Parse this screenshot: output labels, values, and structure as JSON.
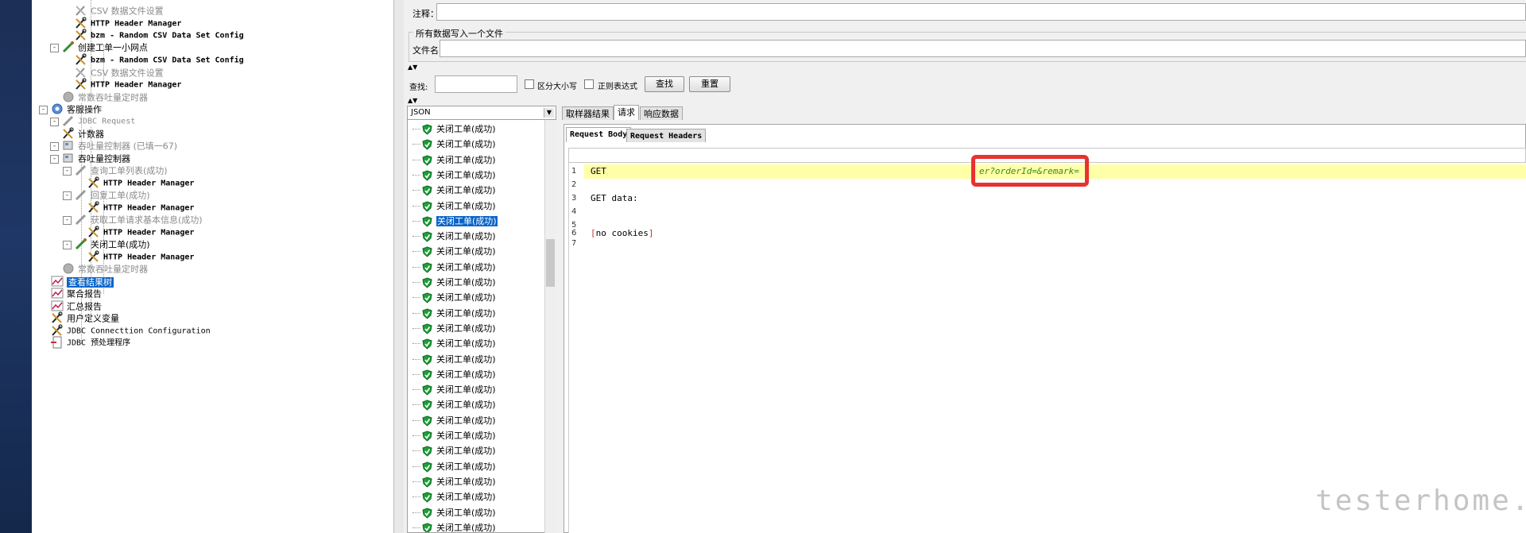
{
  "tree": {
    "items": [
      {
        "label": "CSV 数据文件设置",
        "disabled": true
      },
      {
        "label": "HTTP Header Manager",
        "bold": true
      },
      {
        "label": "bzm - Random CSV Data Set Config",
        "bold": true
      },
      {
        "label": "创建工单一小网点"
      },
      {
        "label": "bzm - Random CSV Data Set Config",
        "bold": true
      },
      {
        "label": "CSV 数据文件设置",
        "disabled": true
      },
      {
        "label": "HTTP Header Manager",
        "bold": true
      },
      {
        "label": "常数吞吐量定时器",
        "disabled": true
      },
      {
        "label": "客服操作"
      },
      {
        "label": "JDBC Request",
        "disabled": true
      },
      {
        "label": "计数器"
      },
      {
        "label": "吞吐量控制器 (已填一67)",
        "disabled": true
      },
      {
        "label": "吞吐量控制器"
      },
      {
        "label": "查询工单列表(成功)",
        "disabled": true
      },
      {
        "label": "HTTP Header Manager",
        "bold": true
      },
      {
        "label": "回复工单(成功)",
        "disabled": true
      },
      {
        "label": "HTTP Header Manager",
        "bold": true
      },
      {
        "label": "获取工单请求基本信息(成功)",
        "disabled": true
      },
      {
        "label": "HTTP Header Manager",
        "bold": true
      },
      {
        "label": "关闭工单(成功)"
      },
      {
        "label": "HTTP Header Manager",
        "bold": true
      },
      {
        "label": "常数吞吐量定时器",
        "disabled": true
      },
      {
        "label": "查看结果树",
        "selected": true
      },
      {
        "label": "聚合报告"
      },
      {
        "label": "汇总报告"
      },
      {
        "label": "用户定义变量"
      },
      {
        "label": "JDBC Connecttion Configuration"
      },
      {
        "label": "JDBC 预处理程序"
      }
    ]
  },
  "form": {
    "comment_label": "注释：",
    "write_all_label": "所有数据写入一个文件",
    "filename_label": "文件名"
  },
  "search": {
    "label": "查找:",
    "case_label": "区分大小写",
    "regex_label": "正则表达式",
    "find_button": "查找",
    "reset_button": "重置"
  },
  "renderer": {
    "selected": "JSON"
  },
  "results": {
    "label": "关闭工单(成功)",
    "selected_index": 6,
    "count": 28
  },
  "tabs": {
    "main": [
      "取样器结果",
      "请求",
      "响应数据"
    ],
    "main_active": 1,
    "sub": [
      "Request Body",
      "Request Headers"
    ],
    "sub_active": 0
  },
  "editor": {
    "line_numbers": [
      "1",
      "2",
      "3",
      "4",
      "5",
      "6",
      "7"
    ],
    "line1": "GET",
    "url_fragment": "er?orderId=&remark=",
    "line3": "GET data:",
    "line6_open": "[",
    "line6_text": "no cookies",
    "line6_close": "]"
  },
  "watermark": "testerhome.com",
  "colors": {
    "selection": "#0a64c8",
    "highlight": "#ffffa8",
    "annotation": "#e8322e"
  }
}
